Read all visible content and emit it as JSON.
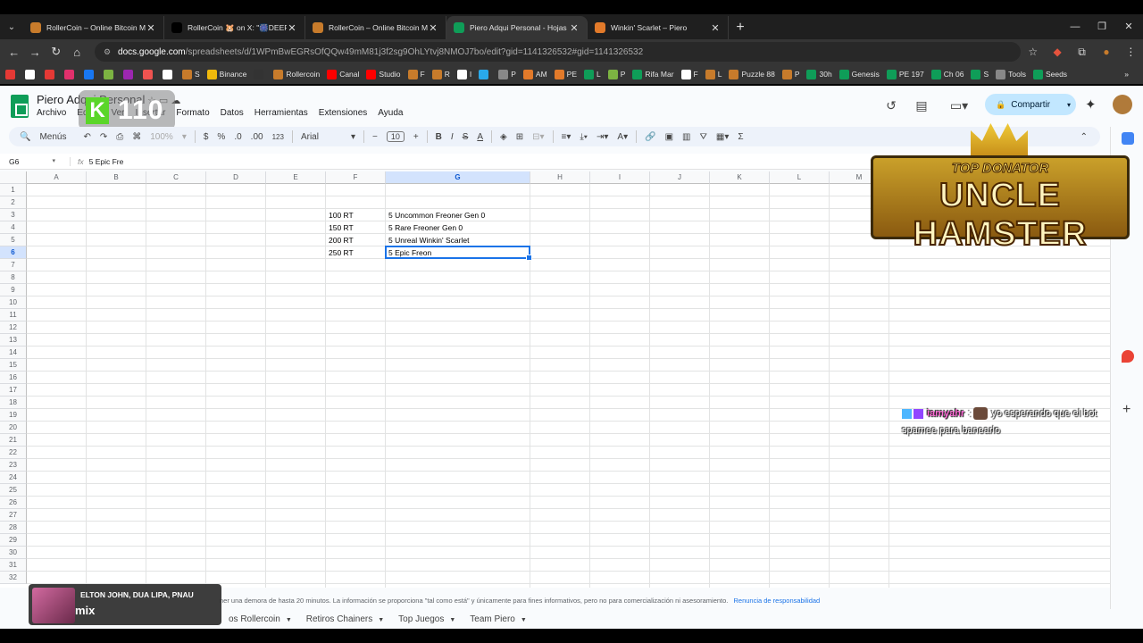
{
  "browser": {
    "tabs": [
      {
        "title": "RollerCoin – Online Bitcoin Min",
        "fav_color": "#c77b2b",
        "active": false
      },
      {
        "title": "RollerCoin 🐹 on X: \"🎆DEEP D",
        "fav_color": "#000000",
        "active": false
      },
      {
        "title": "RollerCoin – Online Bitcoin Min",
        "fav_color": "#c77b2b",
        "active": false
      },
      {
        "title": "Piero Adqui Personal - Hojas de",
        "fav_color": "#0f9d58",
        "active": true
      },
      {
        "title": "Winkin' Scarlet – Piero",
        "fav_color": "#e27a2a",
        "active": false
      }
    ],
    "url_host": "docs.google.com",
    "url_path": "/spreadsheets/d/1WPmBwEGRsOfQQw49mM81j3f2sg9OhLYtvj8NMOJ7bo/edit?gid=1141326532#gid=1141326532",
    "bookmarks": [
      {
        "label": "",
        "color": "#e53935"
      },
      {
        "label": "",
        "color": "#ffffff"
      },
      {
        "label": "",
        "color": "#e53935"
      },
      {
        "label": "",
        "color": "#e1306c"
      },
      {
        "label": "",
        "color": "#1877f2"
      },
      {
        "label": "",
        "color": "#7cb342"
      },
      {
        "label": "",
        "color": "#9c27b0"
      },
      {
        "label": "",
        "color": "#ef5350"
      },
      {
        "label": "",
        "color": "#ffffff"
      },
      {
        "label": "S",
        "color": "#c77b2b"
      },
      {
        "label": "Binance",
        "color": "#f0b90b"
      },
      {
        "label": "",
        "color": "#333333"
      },
      {
        "label": "Rollercoin",
        "color": "#c77b2b"
      },
      {
        "label": "Canal",
        "color": "#ff0000"
      },
      {
        "label": "Studio",
        "color": "#ff0000"
      },
      {
        "label": "F",
        "color": "#c77b2b"
      },
      {
        "label": "R",
        "color": "#c77b2b"
      },
      {
        "label": "I",
        "color": "#ffffff"
      },
      {
        "label": "",
        "color": "#29a9eb"
      },
      {
        "label": "P",
        "color": "#888888"
      },
      {
        "label": "AM",
        "color": "#e27a2a"
      },
      {
        "label": "PE",
        "color": "#e27a2a"
      },
      {
        "label": "L",
        "color": "#0f9d58"
      },
      {
        "label": "P",
        "color": "#7cb342"
      },
      {
        "label": "Rifa Mar",
        "color": "#0f9d58"
      },
      {
        "label": "F",
        "color": "#ffffff"
      },
      {
        "label": "L",
        "color": "#c77b2b"
      },
      {
        "label": "Puzzle 88",
        "color": "#c77b2b"
      },
      {
        "label": "P",
        "color": "#c77b2b"
      },
      {
        "label": "30h",
        "color": "#0f9d58"
      },
      {
        "label": "Genesis",
        "color": "#0f9d58"
      },
      {
        "label": "PE 197",
        "color": "#0f9d58"
      },
      {
        "label": "Ch 06",
        "color": "#0f9d58"
      },
      {
        "label": "S",
        "color": "#0f9d58"
      },
      {
        "label": "Tools",
        "color": "#888888"
      },
      {
        "label": "Seeds",
        "color": "#0f9d58"
      }
    ]
  },
  "sheets": {
    "doc_title": "Piero Adqui Personal",
    "menu": [
      "Archivo",
      "Editar",
      "Ver",
      "Insertar",
      "Formato",
      "Datos",
      "Herramientas",
      "Extensiones",
      "Ayuda"
    ],
    "share_label": "Compartir",
    "toolbar": {
      "search": "Menús",
      "zoom": "100%",
      "currency": "$",
      "percent": "%",
      "dec_less": ".0",
      "dec_more": ".00",
      "num_format": "123",
      "font": "Arial",
      "font_size": "10"
    },
    "name_box": "G6",
    "formula": "5 Epic Fre",
    "columns": [
      "A",
      "B",
      "C",
      "D",
      "E",
      "F",
      "G",
      "H",
      "I",
      "J",
      "K",
      "L",
      "M"
    ],
    "rows": [
      "1",
      "2",
      "3",
      "4",
      "5",
      "6",
      "7",
      "8",
      "9",
      "10",
      "11",
      "12",
      "13",
      "14",
      "15",
      "16",
      "17",
      "18",
      "19",
      "20",
      "21",
      "22",
      "23",
      "24",
      "25",
      "26",
      "27",
      "28",
      "29",
      "30",
      "31",
      "32"
    ],
    "cells": {
      "F3": "100 RT",
      "G3": "5 Uncommon Freoner Gen 0",
      "F4": "150 RT",
      "G4": "5 Rare Freoner Gen 0",
      "F5": "200 RT",
      "G5": "5 Unreal Winkin' Scarlet",
      "F6": "250 RT",
      "G6": "5 Epic Freon"
    },
    "footer_note": "ner una demora de hasta 20 minutos. La información se proporciona \"tal como está\" y únicamente para fines informativos, pero no para comercialización ni asesoramiento.",
    "footer_link": "Renuncia de responsabilidad",
    "sheet_tabs": [
      "os Rollercoin",
      "Retiros Chainers",
      "Top Juegos",
      "Team Piero"
    ]
  },
  "overlays": {
    "counter": "110",
    "banner_line1": "TOP DONATOR",
    "banner_line2": "UNCLE HAMSTER",
    "chat_user": "iamyahr",
    "chat_message": "yo esperando que el bot spamee para banearlo",
    "music_artist": "ELTON JOHN, DUA LIPA, PNAU",
    "music_track": "mix"
  }
}
